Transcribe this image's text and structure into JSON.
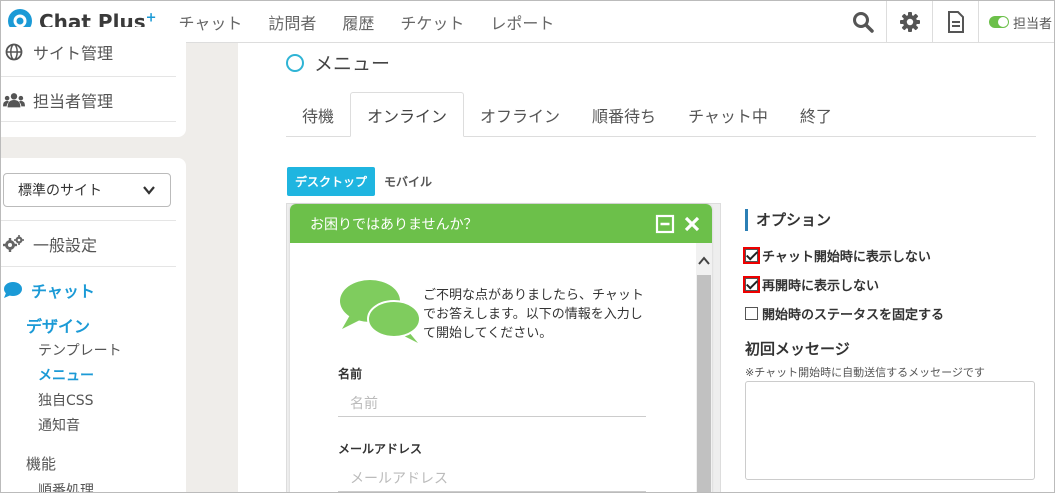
{
  "header": {
    "logo_text": "Chat Plus",
    "logo_plus": "+",
    "nav": [
      "チャット",
      "訪問者",
      "履歴",
      "チケット",
      "レポート"
    ],
    "icons": [
      "search-icon",
      "gear-icon",
      "document-icon"
    ],
    "agent_toggle_label": "担当者",
    "toggle_color": "#6cc04a"
  },
  "sidebar": {
    "top_items": [
      {
        "label": "サイト管理",
        "icon": "globe-icon"
      },
      {
        "label": "担当者管理",
        "icon": "users-icon"
      }
    ],
    "site_select": "標準のサイト",
    "general": {
      "label": "一般設定",
      "icon": "gears-icon"
    },
    "chat": {
      "label": "チャット",
      "icon": "chat-bubble-icon"
    },
    "design": "デザイン",
    "design_items": [
      "テンプレート",
      "メニュー",
      "独自CSS",
      "通知音"
    ],
    "features": "機能",
    "features_items": [
      "順番処理"
    ]
  },
  "main": {
    "title": "メニュー",
    "tabs": [
      "待機",
      "オンライン",
      "オフライン",
      "順番待ち",
      "チャット中",
      "終了"
    ],
    "active_tab": "オンライン",
    "device_tabs": [
      "デスクトップ",
      "モバイル"
    ],
    "accent": "#1fb5e0"
  },
  "widget": {
    "header_text": "お困りではありませんか？",
    "header_color": "#6cc04a",
    "intro": [
      "ご不明な点がありましたら、チャット",
      "でお答えします。以下の情報を入力し",
      "て開始してください。"
    ],
    "fields": [
      {
        "label": "名前",
        "placeholder": "名前"
      },
      {
        "label": "メールアドレス",
        "placeholder": "メールアドレス"
      }
    ]
  },
  "options": {
    "title": "オプション",
    "items": [
      {
        "label": "チャット開始時に表示しない",
        "checked": true
      },
      {
        "label": "再開時に表示しない",
        "checked": true
      },
      {
        "label": "開始時のステータスを固定する",
        "checked": false
      }
    ],
    "initial_title": "初回メッセージ",
    "initial_note": "※チャット開始時に自動送信するメッセージです"
  }
}
